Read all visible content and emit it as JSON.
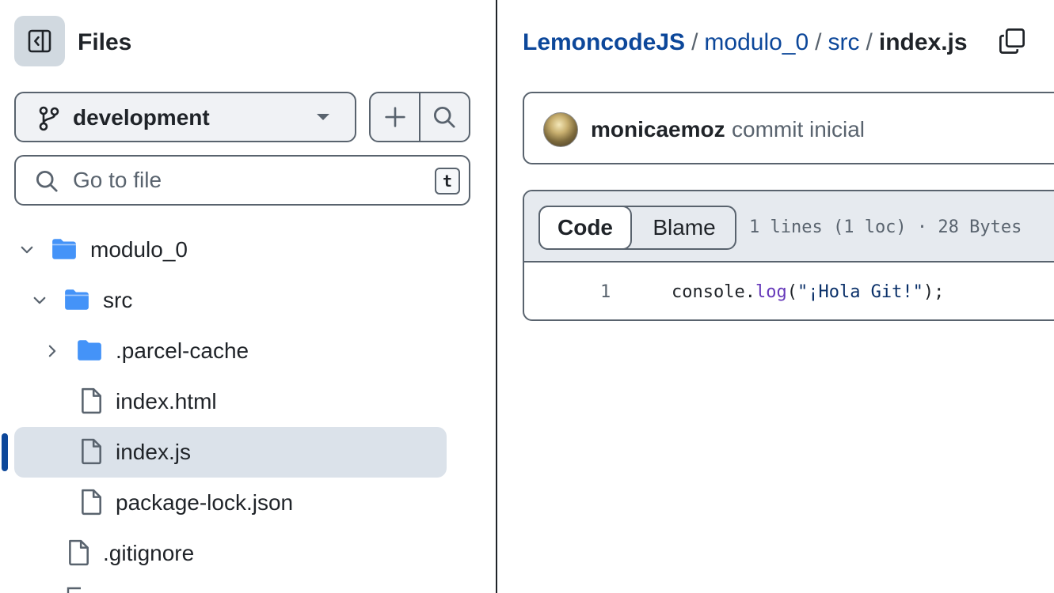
{
  "sidebar": {
    "title": "Files",
    "branch": "development",
    "goto_placeholder": "Go to file",
    "goto_shortcut": "t",
    "tree": [
      {
        "label": "modulo_0",
        "kind": "folder",
        "expanded": true
      },
      {
        "label": "src",
        "kind": "folder",
        "expanded": true
      },
      {
        "label": ".parcel-cache",
        "kind": "folder",
        "expanded": false
      },
      {
        "label": "index.html",
        "kind": "file"
      },
      {
        "label": "index.js",
        "kind": "file",
        "selected": true
      },
      {
        "label": "package-lock.json",
        "kind": "file"
      },
      {
        "label": ".gitignore",
        "kind": "file"
      }
    ]
  },
  "breadcrumb": {
    "repo": "LemoncodeJS",
    "sep": "/",
    "parts": [
      "modulo_0",
      "src"
    ],
    "current": "index.js"
  },
  "commit": {
    "author": "monicaemoz",
    "message": "commit inicial"
  },
  "viewer": {
    "tabs": [
      "Code",
      "Blame"
    ],
    "active_tab": "Code",
    "meta": "1 lines (1 loc) · 28 Bytes",
    "lines": [
      {
        "number": "1",
        "obj": "console.",
        "fn": "log",
        "open": "(",
        "str": "\"¡Hola Git!\"",
        "close": ");"
      }
    ]
  },
  "colors": {
    "link": "#0c479a",
    "selection": "#dbe2ea",
    "folder": "#4493f8"
  }
}
